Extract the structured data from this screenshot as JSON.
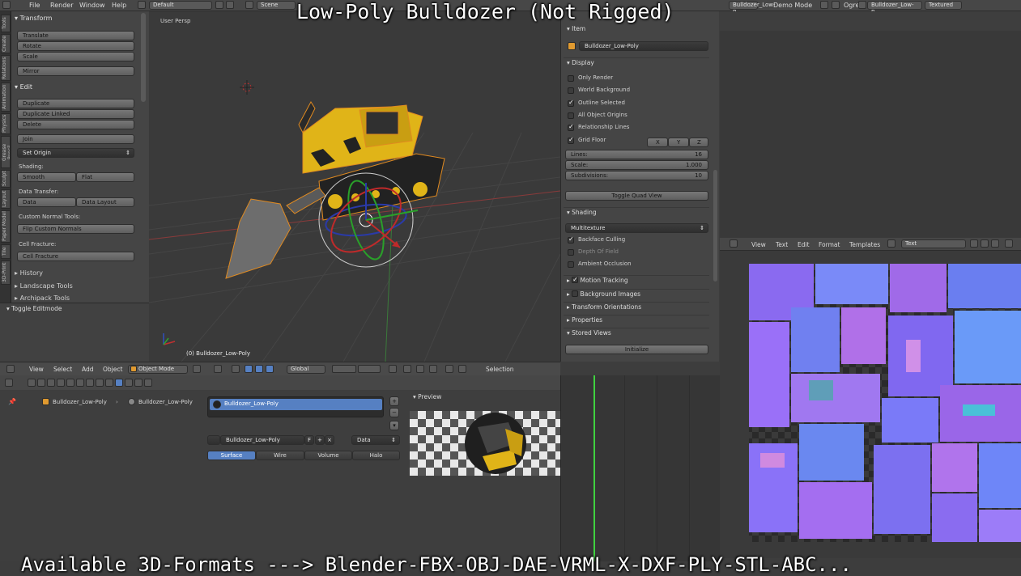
{
  "overlay": {
    "title": "Low-Poly Bulldozer (Not Rigged)",
    "formats": "Available 3D-Formats ---> Blender-FBX-OBJ-DAE-VRML-X-DXF-PLY-STL-ABC..."
  },
  "menubar": {
    "items": [
      "File",
      "Render",
      "Window",
      "Help"
    ],
    "layout": "Default",
    "scene": "Scene",
    "engine": "Ogre",
    "engine_mode": "Demo Mode",
    "object_field": "Bulldozer_Low-P...",
    "shading": "Textured"
  },
  "toolshelf": {
    "tabs": [
      "Tools",
      "Create",
      "Relations",
      "Animation",
      "Physics",
      "Grease Pencil",
      "Sculpt",
      "Layout",
      "Paper Model",
      "Tile",
      "3D-Print"
    ],
    "transform": {
      "header": "Transform",
      "buttons": [
        "Translate",
        "Rotate",
        "Scale",
        "Mirror"
      ]
    },
    "edit": {
      "header": "Edit",
      "buttons": [
        "Duplicate",
        "Duplicate Linked",
        "Delete",
        "Join"
      ],
      "set_origin": "Set Origin",
      "shading_label": "Shading:",
      "smooth": "Smooth",
      "flat": "Flat",
      "data_transfer_label": "Data Transfer:",
      "data": "Data",
      "data_layout": "Data Layout",
      "custom_normal_label": "Custom Normal Tools:",
      "flip_normals": "Flip Custom Normals",
      "cell_fracture_label": "Cell Fracture:",
      "cell_fracture": "Cell Fracture"
    },
    "collapsed": [
      "History",
      "Landscape Tools",
      "Archipack Tools"
    ],
    "operator": "Toggle Editmode"
  },
  "viewport": {
    "label": "User Persp",
    "object_label": "(0) Bulldozer_Low-Poly"
  },
  "npanel": {
    "item_header": "Item",
    "object_name": "Bulldozer_Low-Poly",
    "display_header": "Display",
    "display_options": [
      {
        "label": "Only Render",
        "checked": false
      },
      {
        "label": "World Background",
        "checked": false
      },
      {
        "label": "Outline Selected",
        "checked": true
      },
      {
        "label": "All Object Origins",
        "checked": false
      },
      {
        "label": "Relationship Lines",
        "checked": true
      },
      {
        "label": "Grid Floor",
        "checked": true
      }
    ],
    "axes": [
      "X",
      "Y",
      "Z"
    ],
    "lines_label": "Lines:",
    "lines_value": "16",
    "scale_label": "Scale:",
    "scale_value": "1.000",
    "subdiv_label": "Subdivisions:",
    "subdiv_value": "10",
    "quad_view": "Toggle Quad View",
    "shading_header": "Shading",
    "shading_mode": "Multitexture",
    "shading_options": [
      {
        "label": "Backface Culling",
        "checked": true
      },
      {
        "label": "Depth Of Field",
        "checked": false
      },
      {
        "label": "Ambient Occlusion",
        "checked": false
      }
    ],
    "collapsed": [
      "Motion Tracking",
      "Background Images",
      "Transform Orientations",
      "Properties"
    ],
    "stored_views": "Stored Views",
    "initialize": "Initialize"
  },
  "view3d_header": {
    "menus": [
      "View",
      "Select",
      "Add",
      "Object"
    ],
    "mode": "Object Mode",
    "orientation": "Global",
    "selection": "Selection"
  },
  "text_editor": {
    "menus": [
      "View",
      "Text",
      "Edit",
      "Format",
      "Templates"
    ],
    "text": "Text"
  },
  "properties": {
    "breadcrumb_1": "Bulldozer_Low-Poly",
    "breadcrumb_2": "Bulldozer_Low-Poly",
    "material_slot": "Bulldozer_Low-Poly",
    "material_name": "Bulldozer_Low-Poly",
    "fake_user": "F",
    "data_select": "Data",
    "tabs": [
      "Surface",
      "Wire",
      "Volume",
      "Halo"
    ],
    "preview_label": "Preview"
  },
  "colors": {
    "bulldozer_yellow": "#e0b418",
    "select_blue": "#5680c2",
    "timeline_green": "#3fd23f"
  }
}
